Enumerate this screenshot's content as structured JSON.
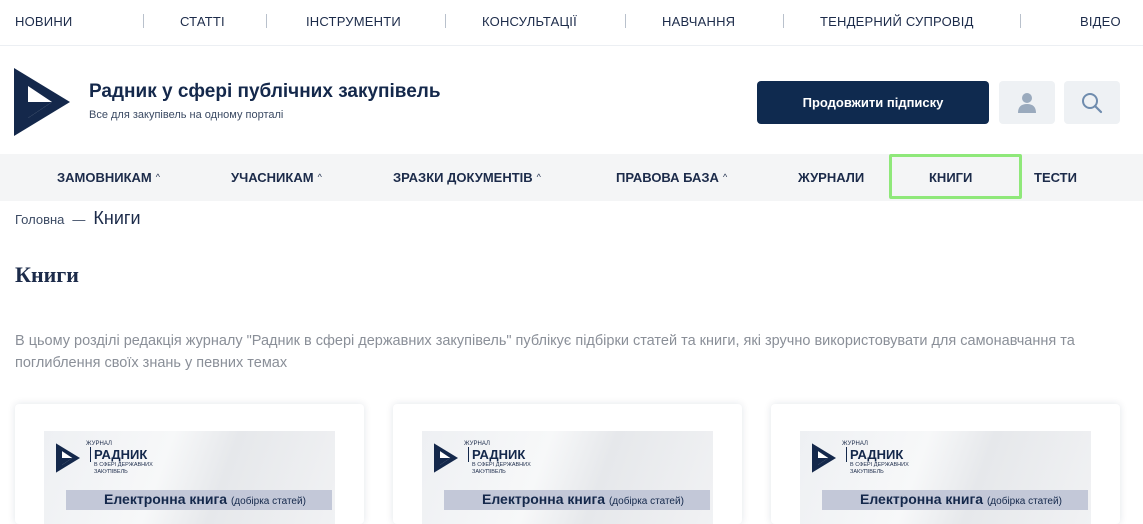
{
  "top_nav": [
    "НОВИНИ",
    "СТАТТІ",
    "ІНСТРУМЕНТИ",
    "КОНСУЛЬТАЦІЇ",
    "НАВЧАННЯ",
    "ТЕНДЕРНИЙ СУПРОВІД",
    "ВІДЕО"
  ],
  "header": {
    "title": "Радник у сфері публічних закупівель",
    "subtitle": "Все для закупівель на одному порталі",
    "subscribe_label": "Продовжити підписку"
  },
  "main_nav": [
    {
      "label": "ЗАМОВНИКАМ",
      "caret": "^"
    },
    {
      "label": "УЧАСНИКАМ",
      "caret": "^"
    },
    {
      "label": "ЗРАЗКИ ДОКУМЕНТІВ",
      "caret": "^"
    },
    {
      "label": "ПРАВОВА БАЗА",
      "caret": "^"
    },
    {
      "label": "ЖУРНАЛИ",
      "caret": ""
    },
    {
      "label": "КНИГИ",
      "caret": "",
      "active": true
    },
    {
      "label": "ТЕСТИ",
      "caret": ""
    }
  ],
  "breadcrumb": {
    "home": "Головна",
    "separator": "—",
    "current": "Книги"
  },
  "page_title": "Книги",
  "intro": "В цьому розділі редакція журналу \"Радник в сфері державних закупівель\" публікує підбірки статей та книги, які зручно використовувати для самонавчання та поглиблення своїх знань у певних темах",
  "cards": [
    {
      "kicker": "ЖУРНАЛ",
      "brand": "РАДНИК",
      "brand_sub": "В СФЕРІ ДЕРЖАВНИХ ЗАКУПІВЕЛЬ",
      "label": "Електронна книга",
      "label_note": "(добірка статей)"
    },
    {
      "kicker": "ЖУРНАЛ",
      "brand": "РАДНИК",
      "brand_sub": "В СФЕРІ ДЕРЖАВНИХ ЗАКУПІВЕЛЬ",
      "label": "Електронна книга",
      "label_note": "(добірка статей)"
    },
    {
      "kicker": "ЖУРНАЛ",
      "brand": "РАДНИК",
      "brand_sub": "В СФЕРІ ДЕРЖАВНИХ ЗАКУПІВЕЛЬ",
      "label": "Електронна книга",
      "label_note": "(добірка статей)"
    }
  ],
  "colors": {
    "brand": "#0f2a4f",
    "active_outline": "#8fe87a",
    "nav_bg": "#f4f5f6"
  },
  "icons": {
    "user": "user-icon",
    "search": "search-icon"
  }
}
